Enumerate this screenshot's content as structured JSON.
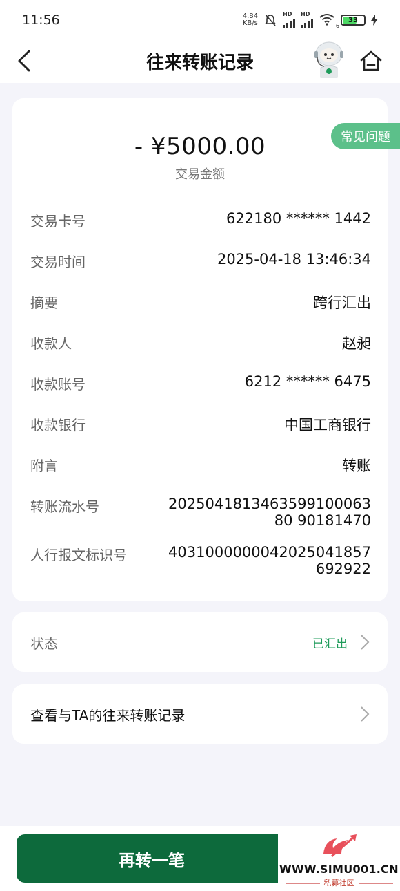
{
  "status_bar": {
    "time": "11:56",
    "net_speed_value": "4.84",
    "net_speed_unit": "KB/s",
    "hd1": "HD",
    "hd2": "HD",
    "wifi_sub": "6",
    "battery": "33"
  },
  "header": {
    "title": "往来转账记录",
    "icons": [
      "back-arrow-icon",
      "robot-assistant-icon",
      "home-icon"
    ]
  },
  "faq_label": "常见问题",
  "transaction": {
    "amount": "- ¥5000.00",
    "amount_label": "交易金额",
    "rows": [
      {
        "label": "交易卡号",
        "value": "622180 ****** 1442"
      },
      {
        "label": "交易时间",
        "value": "2025-04-18 13:46:34"
      },
      {
        "label": "摘要",
        "value": "跨行汇出"
      },
      {
        "label": "收款人",
        "value": "赵昶"
      },
      {
        "label": "收款账号",
        "value": "6212 ****** 6475"
      },
      {
        "label": "收款银行",
        "value": "中国工商银行"
      },
      {
        "label": "附言",
        "value": "转账"
      },
      {
        "label": "转账流水号",
        "value": "202504181346359910006380 90181470"
      },
      {
        "label": "人行报文标识号",
        "value": "4031000000042025041857692922"
      }
    ]
  },
  "status": {
    "label": "状态",
    "value": "已汇出"
  },
  "history_link": "查看与TA的往来转账记录",
  "action_button": "再转一笔",
  "watermark": {
    "site": "WWW.SIMU001.CN",
    "sub": "私募社区"
  },
  "colors": {
    "accent_green": "#0d6a3c",
    "faq_green": "#5cc08a",
    "status_green": "#1e9b5a",
    "page_bg": "#f4f4fa"
  }
}
